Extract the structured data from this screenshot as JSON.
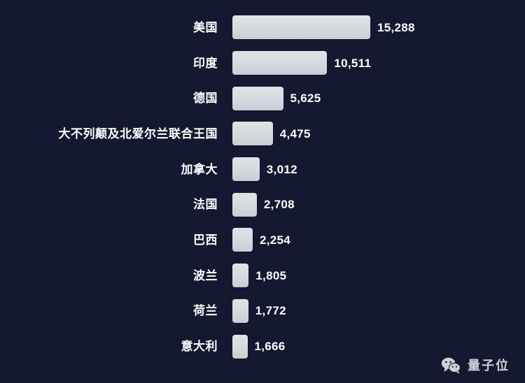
{
  "background_color": "#141830",
  "bar_color": "#d6d9de",
  "text_color": "#ffffff",
  "watermark": {
    "icon": "wechat-icon",
    "text": "量子位"
  },
  "chart_data": {
    "type": "bar",
    "orientation": "horizontal",
    "title": "",
    "subtitle": "",
    "xlabel": "",
    "ylabel": "",
    "grid": false,
    "legend": false,
    "axis_visible": false,
    "value_labels": true,
    "xlim": [
      0,
      15288
    ],
    "categories": [
      "美国",
      "印度",
      "德国",
      "大不列颠及北爱尔兰联合王国",
      "加拿大",
      "法国",
      "巴西",
      "波兰",
      "荷兰",
      "意大利"
    ],
    "values": [
      15288,
      10511,
      5625,
      4475,
      3012,
      2708,
      2254,
      1805,
      1772,
      1666
    ],
    "value_labels_text": [
      "15,288",
      "10,511",
      "5,625",
      "4,475",
      "3,012",
      "2,708",
      "2,254",
      "1,805",
      "1,772",
      "1,666"
    ]
  }
}
